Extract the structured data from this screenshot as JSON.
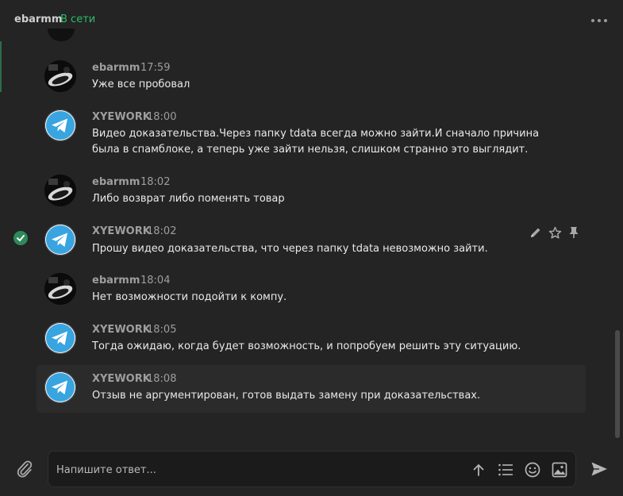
{
  "header": {
    "contact_name": "ebarmm",
    "status": "В сети",
    "more_icon": "more-dots-icon"
  },
  "colors": {
    "online": "#2cbd66",
    "telegram_blue": "#38a4e0",
    "read_check": "#2d8a5a",
    "background": "#242424"
  },
  "messages": [
    {
      "author": "ebarmm",
      "time": "17:59",
      "text": "Уже все пробовал",
      "avatar": "user-photo"
    },
    {
      "author": "XYEWORK",
      "time": "18:00",
      "text": "Видео доказательства.Через папку tdata всегда можно зайти.И сначало причина была в спамблоке, а теперь уже зайти нельзя, слишком странно это выглядит.",
      "avatar": "telegram-logo"
    },
    {
      "author": "ebarmm",
      "time": "18:02",
      "text": "Либо возврат либо поменять товар",
      "avatar": "user-photo"
    },
    {
      "author": "XYEWORK",
      "time": "18:02",
      "text": "Прошу видео доказательства, что через папку tdata невозможно зайти.",
      "avatar": "telegram-logo"
    },
    {
      "author": "ebarmm",
      "time": "18:04",
      "text": "Нет возможности подойти к компу.",
      "avatar": "user-photo"
    },
    {
      "author": "XYEWORK",
      "time": "18:05",
      "text": "Тогда ожидаю, когда будет возможность, и попробуем решить эту ситуацию.",
      "avatar": "telegram-logo"
    },
    {
      "author": "XYEWORK",
      "time": "18:08",
      "text": "Отзыв не аргументирован, готов выдать замену при доказательствах.",
      "avatar": "telegram-logo"
    }
  ],
  "composer": {
    "placeholder": "Напишите ответ..."
  }
}
